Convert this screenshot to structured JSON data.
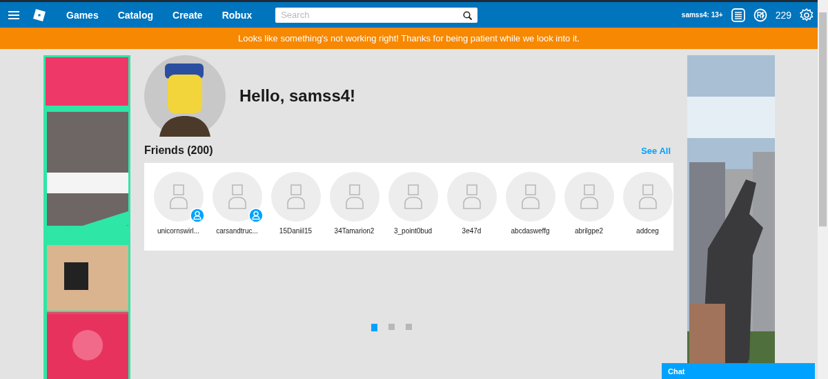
{
  "nav": {
    "items": [
      "Games",
      "Catalog",
      "Create",
      "Robux"
    ],
    "search": {
      "placeholder": "Search"
    },
    "username": "samss4: 13+",
    "robux": "229"
  },
  "banner": {
    "message": "Looks like something's not working right! Thanks for being patient while we look into it."
  },
  "profile": {
    "greeting": "Hello, samss4!"
  },
  "friends": {
    "title": "Friends (200)",
    "see_all": "See All",
    "items": [
      {
        "name": "unicornswirl...",
        "online": true
      },
      {
        "name": "carsandtruc...",
        "online": true
      },
      {
        "name": "15Daniil15",
        "online": false
      },
      {
        "name": "34Tamarion2",
        "online": false
      },
      {
        "name": "3_point0bud",
        "online": false
      },
      {
        "name": "3e47d",
        "online": false
      },
      {
        "name": "abcdasweffg",
        "online": false
      },
      {
        "name": "abrilgpe2",
        "online": false
      },
      {
        "name": "addceg",
        "online": false
      }
    ]
  },
  "carousel": [
    {
      "selected": true
    },
    {
      "selected": false
    },
    {
      "selected": false
    }
  ],
  "chat": {
    "label": "Chat"
  }
}
